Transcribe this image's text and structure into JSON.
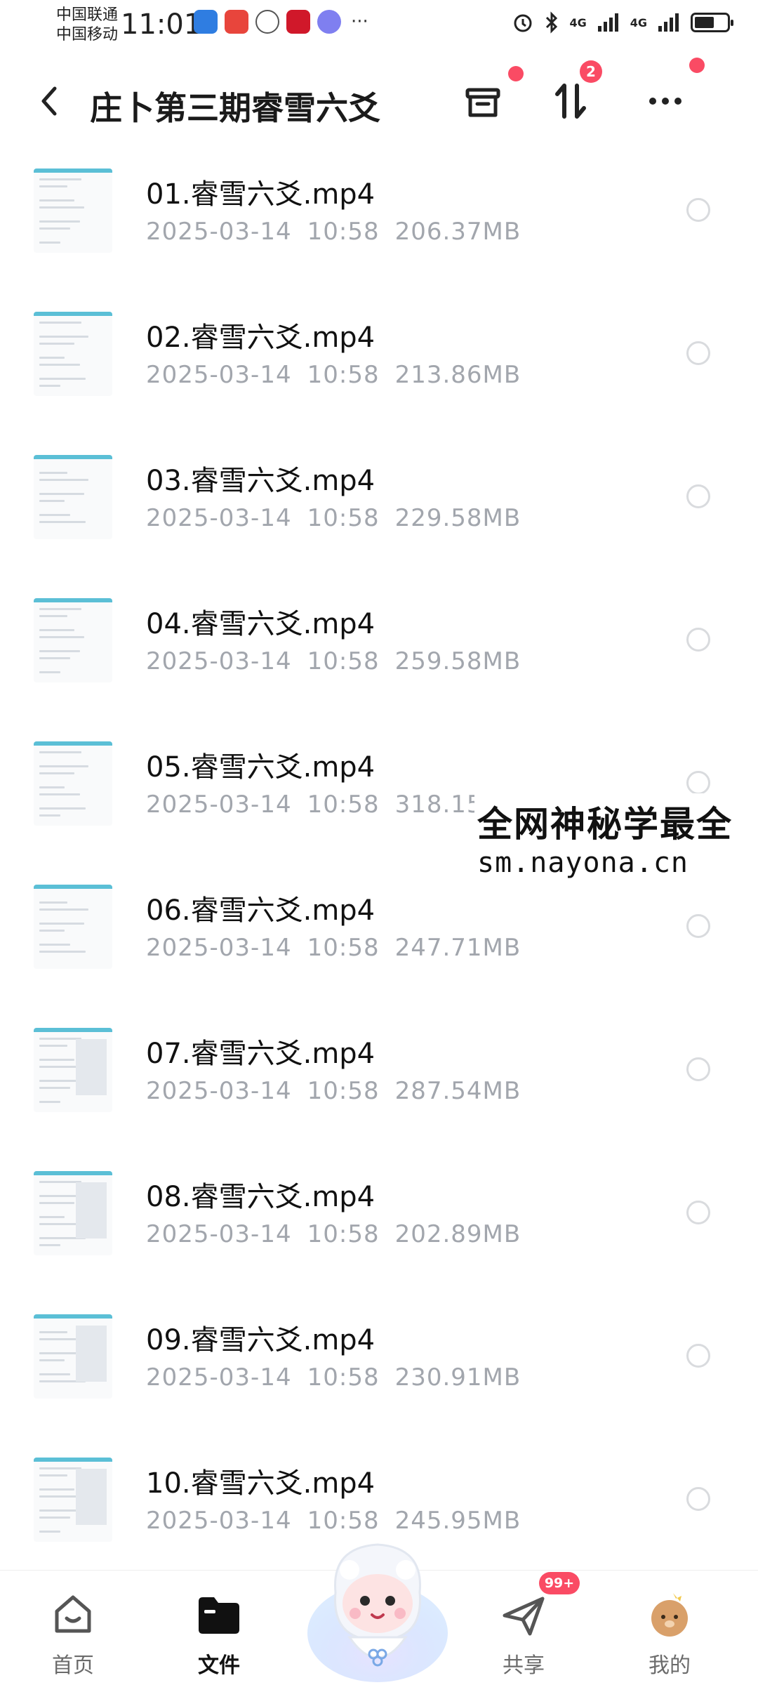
{
  "status_bar": {
    "carrier_1": "中国联通",
    "carrier_2": "中国移动",
    "time": "11:01",
    "net_1": "4G",
    "net_2": "4G",
    "battery_level": 0.65
  },
  "header": {
    "title": "庄卜第三期睿雪六爻",
    "sort_badge": "2"
  },
  "files": [
    {
      "name": "01.睿雪六爻.mp4",
      "date": "2025-03-14",
      "time": "10:58",
      "size": "206.37MB"
    },
    {
      "name": "02.睿雪六爻.mp4",
      "date": "2025-03-14",
      "time": "10:58",
      "size": "213.86MB"
    },
    {
      "name": "03.睿雪六爻.mp4",
      "date": "2025-03-14",
      "time": "10:58",
      "size": "229.58MB"
    },
    {
      "name": "04.睿雪六爻.mp4",
      "date": "2025-03-14",
      "time": "10:58",
      "size": "259.58MB"
    },
    {
      "name": "05.睿雪六爻.mp4",
      "date": "2025-03-14",
      "time": "10:58",
      "size": "318.15MB"
    },
    {
      "name": "06.睿雪六爻.mp4",
      "date": "2025-03-14",
      "time": "10:58",
      "size": "247.71MB"
    },
    {
      "name": "07.睿雪六爻.mp4",
      "date": "2025-03-14",
      "time": "10:58",
      "size": "287.54MB"
    },
    {
      "name": "08.睿雪六爻.mp4",
      "date": "2025-03-14",
      "time": "10:58",
      "size": "202.89MB"
    },
    {
      "name": "09.睿雪六爻.mp4",
      "date": "2025-03-14",
      "time": "10:58",
      "size": "230.91MB"
    },
    {
      "name": "10.睿雪六爻.mp4",
      "date": "2025-03-14",
      "time": "10:58",
      "size": "245.95MB"
    }
  ],
  "watermark": {
    "line1": "全网神秘学最全",
    "line2": "sm.nayona.cn"
  },
  "bottom_nav": {
    "home": "首页",
    "files": "文件",
    "share": "共享",
    "share_badge": "99+",
    "mine": "我的"
  },
  "colors": {
    "accent_red": "#fa4b64",
    "meta_gray": "#a2a6ad",
    "thumb_band": "#5bbfd6"
  },
  "icons": [
    "back-icon",
    "archive-icon",
    "sort-icon",
    "more-icon",
    "radio-icon",
    "home-icon",
    "folder-icon",
    "send-icon",
    "avatar-icon",
    "mascot-icon"
  ]
}
